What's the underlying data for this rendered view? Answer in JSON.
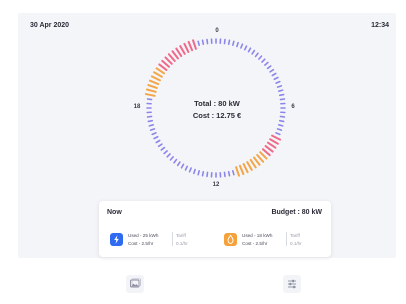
{
  "header": {
    "date": "30 Apr 2020",
    "time": "12:34"
  },
  "dial": {
    "label_top": "0",
    "label_right": "6",
    "label_bottom": "12",
    "label_left": "18",
    "total": "Total : 80 kW",
    "cost": "Cost : 12.75 €"
  },
  "card": {
    "title": "Now",
    "budget": "Budget : 80 kW",
    "electricity": {
      "icon": "lightning-icon",
      "used": "Used - 25 kWh",
      "cost": "Cost - 2.5/hr",
      "tariff_label": "Tariff",
      "tariff_value": "0.1/hr"
    },
    "gas": {
      "icon": "flame-icon",
      "used": "Used - 18 kWh",
      "cost": "Cost - 2.5/hr",
      "tariff_label": "Tariff",
      "tariff_value": "0.1/hr"
    }
  },
  "bottom_nav": {
    "left_icon": "image-gallery-icon",
    "right_icon": "sliders-icon"
  },
  "colors": {
    "accent_blue": "#2f6bf0",
    "accent_orange": "#f5a23c",
    "tick_purple": "#8d86ea",
    "tick_pink": "#ef6a8a",
    "tick_orange": "#f4a548"
  }
}
